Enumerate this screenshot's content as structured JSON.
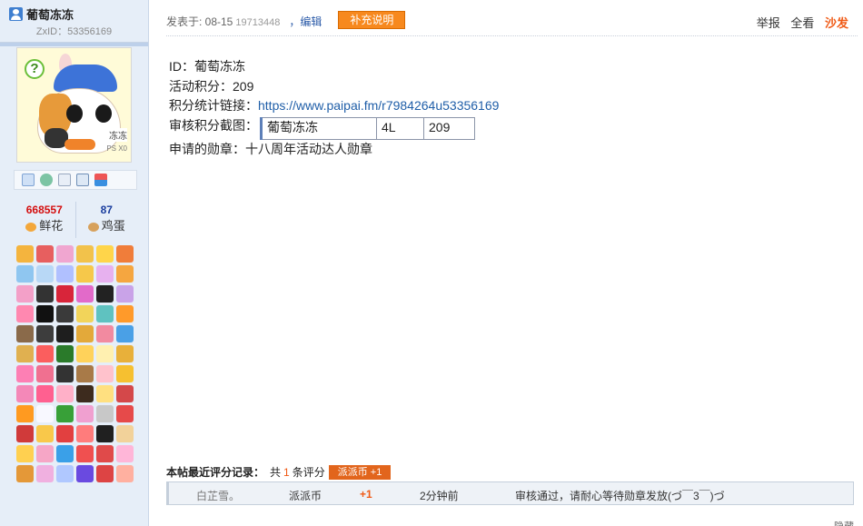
{
  "user": {
    "name": "葡萄冻冻",
    "zxid": "ZxID：53356169",
    "flowers_count": "668557",
    "flowers_label": "鲜花",
    "eggs_count": "87",
    "eggs_label": "鸡蛋",
    "avatar_tag": "冻冻",
    "avatar_tag2": "PS X0",
    "avatar_mark": "?"
  },
  "toolbar_icons": [
    "mail-icon",
    "add-friend-icon",
    "profile-icon",
    "card-icon",
    "gift-icon"
  ],
  "medal_colors": [
    "#f4b43e",
    "#e75f5f",
    "#f0a6d0",
    "#f2c24b",
    "#ffd54a",
    "#f07d3a",
    "#8fc6f0",
    "#b8d8f6",
    "#b0c0ff",
    "#f6c84a",
    "#e7b1ef",
    "#f5a640",
    "#f3a0c8",
    "#333333",
    "#d8253a",
    "#e26ac9",
    "#222222",
    "#c9a3e8",
    "#ff88b0",
    "#111111",
    "#3a3a3a",
    "#f2d45a",
    "#5fc2c0",
    "#ff9a2a",
    "#8a6a4a",
    "#3d3d3d",
    "#1e1e1e",
    "#e3a93a",
    "#f28aa0",
    "#4aa0e6",
    "#e0b050",
    "#fb5e5e",
    "#2a7a2a",
    "#ffd25a",
    "#fff0b0",
    "#e8b03a",
    "#fd7fb4",
    "#f07090",
    "#333333",
    "#a87a48",
    "#ffc2cc",
    "#f6c030",
    "#f488b8",
    "#ff6090",
    "#ffb0c8",
    "#3d2b1e",
    "#ffe080",
    "#d4484a",
    "#ff9a20",
    "#f8f8ff",
    "#38a038",
    "#f0a0d0",
    "#c8c8c8",
    "#e64a4a",
    "#d03a3a",
    "#f9c84a",
    "#e24040",
    "#ff7c7c",
    "#202020",
    "#f2d29a",
    "#ffd050",
    "#f6a6c6",
    "#3aa0e8",
    "#f05050",
    "#e04a4a",
    "#ffb6d8",
    "#e49838",
    "#f0b0e0",
    "#b0c8ff",
    "#6a4ae0",
    "#dd4444",
    "#ffb0a0"
  ],
  "post": {
    "posted_at": "发表于: 08-15",
    "posted_small": "19713448",
    "edit_label": "，编辑",
    "supplement_button": "补充说明",
    "report": "举报",
    "view_all": "全看",
    "sofa": "沙发",
    "line_id": "ID：葡萄冻冻",
    "line_points": "活动积分：209",
    "link_label": "积分统计链接：",
    "link_url": "https://www.paipai.fm/r7984264u53356169",
    "shot_label": "审核积分截图：",
    "shot_table": [
      "葡萄冻冻",
      "4L",
      "209"
    ],
    "medal_line": "申请的勋章：十八周年活动达人勋章"
  },
  "ratings": {
    "title": "本帖最近评分记录：",
    "total_prefix": "共",
    "total_count": "1",
    "total_suffix": "条评分",
    "badge": "派派币 +1",
    "row": {
      "user": "白芷雪。",
      "kind": "派派币",
      "amount": "+1",
      "time": "2分钟前",
      "reason": "审核通过，请耐心等待勋章发放(づ￣3￣)づ"
    }
  },
  "hide_label": "隐藏"
}
